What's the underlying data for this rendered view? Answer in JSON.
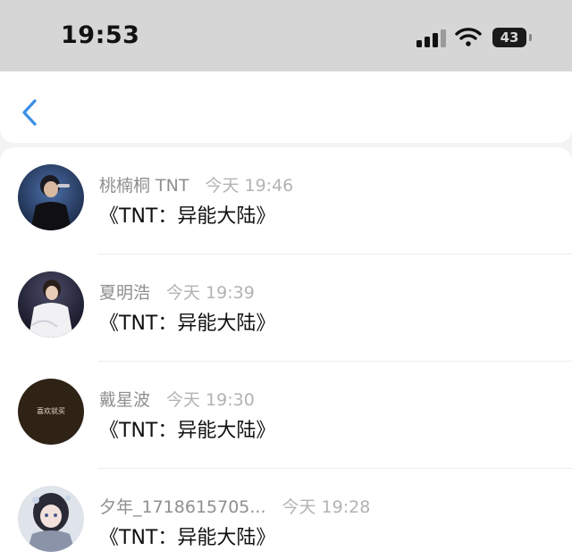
{
  "status_bar": {
    "time": "19:53",
    "battery": "43",
    "icons": [
      "cellular-signal-icon",
      "wifi-icon",
      "battery-icon"
    ]
  },
  "nav": {
    "back_icon": "chevron-left-icon",
    "accent_color": "#3b8fe6"
  },
  "messages": [
    {
      "name": "桃楠桐 TNT",
      "time": "今天 19:46",
      "text": "《TNT：异能大陆》"
    },
    {
      "name": "夏明浩",
      "time": "今天 19:39",
      "text": "《TNT：异能大陆》"
    },
    {
      "name": "戴星波",
      "time": "今天 19:30",
      "text": "《TNT：异能大陆》",
      "avatar_text": "喜欢就买"
    },
    {
      "name": "夕年_1718615705...",
      "time": "今天 19:28",
      "text": "《TNT：异能大陆》"
    }
  ]
}
